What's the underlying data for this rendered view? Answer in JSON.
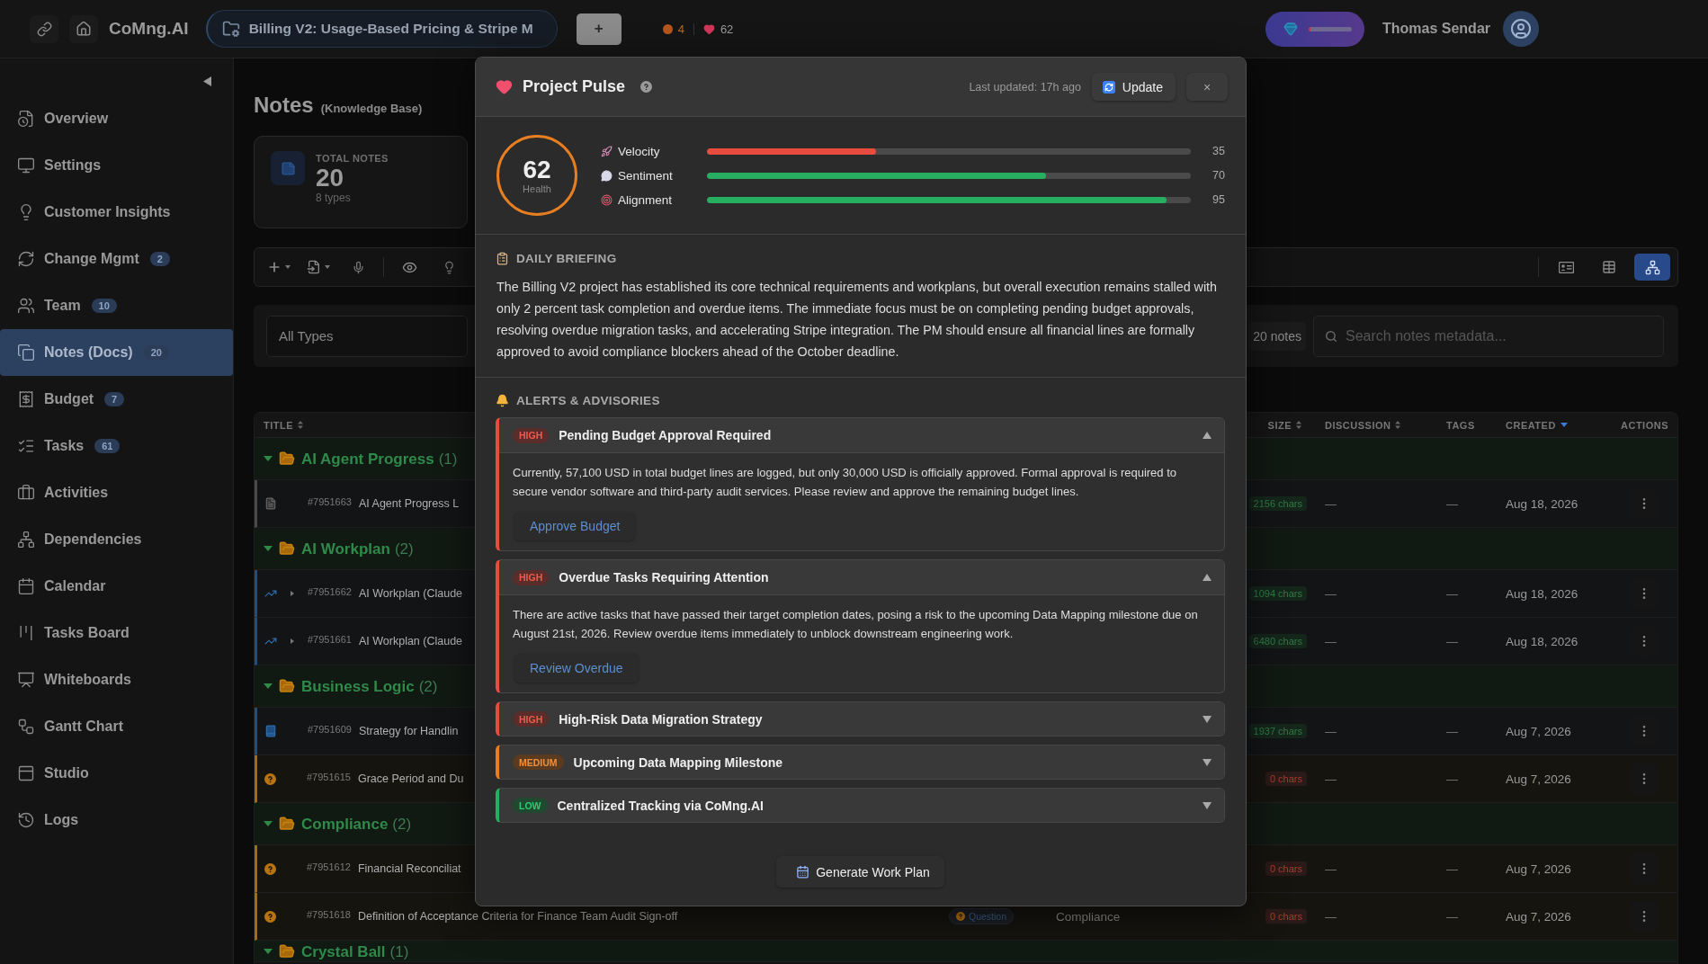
{
  "top_bar": {
    "brand": "CoMng.AI",
    "project": "Billing V2: Usage-Based Pricing & Stripe M",
    "add_button": "+",
    "indicators": [
      {
        "kind": "risk",
        "value": "4"
      },
      {
        "kind": "health",
        "value": "62"
      }
    ],
    "usage_meter": {
      "level": 0.05
    },
    "user_name": "Thomas Sendar"
  },
  "sidebar": {
    "items": [
      {
        "label": "Overview",
        "selected": false
      },
      {
        "label": "Settings",
        "selected": false
      },
      {
        "label": "Customer Insights",
        "selected": false
      },
      {
        "label": "Change Mgmt",
        "badge": "2",
        "selected": false
      },
      {
        "label": "Team",
        "badge": "10",
        "selected": false
      },
      {
        "label": "Notes (Docs)",
        "badge": "20",
        "selected": true
      },
      {
        "label": "Budget",
        "badge": "7",
        "selected": false
      },
      {
        "label": "Tasks",
        "badge": "61",
        "selected": false
      },
      {
        "label": "Activities",
        "selected": false
      },
      {
        "label": "Dependencies",
        "selected": false
      },
      {
        "label": "Calendar",
        "selected": false
      },
      {
        "label": "Tasks Board",
        "selected": false
      },
      {
        "label": "Whiteboards",
        "selected": false
      },
      {
        "label": "Gantt Chart",
        "selected": false
      },
      {
        "label": "Studio",
        "selected": false
      },
      {
        "label": "Logs",
        "selected": false
      }
    ]
  },
  "page": {
    "title": "Notes",
    "subtitle": "(Knowledge Base)",
    "stat_card": {
      "label": "TOTAL NOTES",
      "value": "20",
      "caption": "8 types"
    },
    "view_modes": [
      {
        "kind": "cards",
        "selected": false
      },
      {
        "kind": "table",
        "selected": false
      },
      {
        "kind": "tree",
        "selected": true
      }
    ],
    "type_filter": "All Types",
    "note_count": "20 notes",
    "search": {
      "placeholder": "Search notes metadata..."
    }
  },
  "table": {
    "columns": [
      {
        "label": "TITLE",
        "sortable": true,
        "sorted": false
      },
      {
        "label": "SIZE",
        "sortable": true,
        "sorted": false
      },
      {
        "label": "DISCUSSION",
        "sortable": true,
        "sorted": false
      },
      {
        "label": "TAGS",
        "sortable": false,
        "sorted": false
      },
      {
        "label": "CREATED",
        "sortable": true,
        "sorted": true
      },
      {
        "label": "ACTIONS",
        "sortable": false,
        "sorted": false
      }
    ],
    "groups": [
      {
        "name": "AI Agent Progress",
        "count": "(1)",
        "expanded": true,
        "rows": [
          {
            "kind": "document",
            "has_children": false,
            "id": "#7951663",
            "title": "AI Agent Progress L",
            "size": "2156 chars",
            "empty": false,
            "discussion": "—",
            "tags": "—",
            "created": "Aug 18, 2026"
          }
        ]
      },
      {
        "name": "AI Workplan",
        "count": "(2)",
        "expanded": true,
        "rows": [
          {
            "kind": "chart",
            "has_children": true,
            "id": "#7951662",
            "title": "AI Workplan (Claude",
            "size": "1094 chars",
            "empty": false,
            "discussion": "—",
            "tags": "—",
            "created": "Aug 18, 2026"
          },
          {
            "kind": "chart",
            "has_children": true,
            "id": "#7951661",
            "title": "AI Workplan (Claude",
            "size": "6480 chars",
            "empty": false,
            "discussion": "—",
            "tags": "—",
            "created": "Aug 18, 2026"
          }
        ]
      },
      {
        "name": "Business Logic",
        "count": "(2)",
        "expanded": true,
        "rows": [
          {
            "kind": "book",
            "has_children": false,
            "id": "#7951609",
            "title": "Strategy for Handlin",
            "size": "1937 chars",
            "empty": false,
            "discussion": "—",
            "tags": "—",
            "created": "Aug 7, 2026"
          },
          {
            "kind": "question",
            "has_children": false,
            "id": "#7951615",
            "title": "Grace Period and Du",
            "size": "0 chars",
            "empty": true,
            "discussion": "—",
            "tags": "—",
            "created": "Aug 7, 2026"
          }
        ]
      },
      {
        "name": "Compliance",
        "count": "(2)",
        "expanded": true,
        "rows": [
          {
            "kind": "question",
            "has_children": false,
            "id": "#7951612",
            "title": "Financial Reconciliat",
            "size": "0 chars",
            "empty": true,
            "discussion": "—",
            "tags": "—",
            "created": "Aug 7, 2026"
          },
          {
            "kind": "question",
            "has_children": false,
            "id": "#7951618",
            "title": "Definition of Acceptance Criteria for Finance Team Audit Sign-off",
            "type_tag": "Question",
            "category": "Compliance",
            "size": "0 chars",
            "empty": true,
            "discussion": "—",
            "tags": "—",
            "created": "Aug 7, 2026"
          }
        ]
      },
      {
        "name": "Crystal Ball",
        "count": "(1)",
        "expanded": true
      }
    ]
  },
  "pulse": {
    "title": "Project Pulse",
    "last_updated": "Last updated: 17h ago",
    "update_button": "Update",
    "close_button": "×",
    "health": {
      "score": "62",
      "label": "Health"
    },
    "metrics": [
      {
        "kind": "velocity",
        "label": "Velocity",
        "level": 0.35,
        "reading": "35"
      },
      {
        "kind": "sentiment",
        "label": "Sentiment",
        "level": 0.7,
        "reading": "70"
      },
      {
        "kind": "alignment",
        "label": "Alignment",
        "level": 0.95,
        "reading": "95"
      }
    ],
    "briefing": {
      "heading": "DAILY BRIEFING",
      "text": "The Billing V2 project has established its core technical requirements and workplans, but overall execution remains stalled with only 2 percent task completion and overdue items. The immediate focus must be on completing pending budget approvals, resolving overdue migration tasks, and accelerating Stripe integration. The PM should ensure all financial lines are formally approved to avoid compliance blockers ahead of the October deadline."
    },
    "alerts": {
      "heading": "ALERTS & ADVISORIES",
      "items": [
        {
          "kind": "high",
          "badge": "HIGH",
          "title": "Pending Budget Approval Required",
          "expanded": true,
          "body": "Currently, 57,100 USD in total budget lines are logged, but only 30,000 USD is officially approved. Formal approval is required to secure vendor software and third-party audit services. Please review and approve the remaining budget lines.",
          "action": "Approve Budget"
        },
        {
          "kind": "high",
          "badge": "HIGH",
          "title": "Overdue Tasks Requiring Attention",
          "expanded": true,
          "body": "There are active tasks that have passed their target completion dates, posing a risk to the upcoming Data Mapping milestone due on August 21st, 2026. Review overdue items immediately to unblock downstream engineering work.",
          "action": "Review Overdue"
        },
        {
          "kind": "high",
          "badge": "HIGH",
          "title": "High-Risk Data Migration Strategy",
          "expanded": false
        },
        {
          "kind": "medium",
          "badge": "MEDIUM",
          "title": "Upcoming Data Mapping Milestone",
          "expanded": false
        },
        {
          "kind": "low",
          "badge": "LOW",
          "title": "Centralized Tracking via CoMng.AI",
          "expanded": false
        }
      ]
    },
    "generate_button": "Generate Work Plan"
  }
}
